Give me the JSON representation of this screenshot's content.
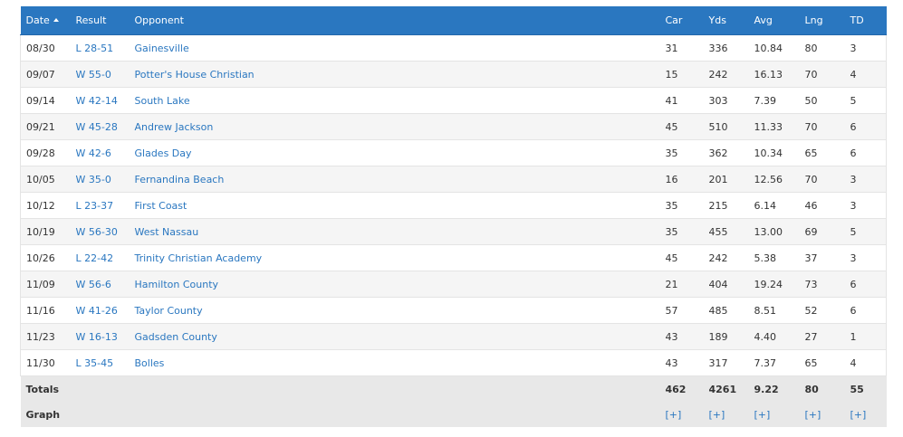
{
  "table": {
    "headers": {
      "date": "Date",
      "result": "Result",
      "opponent": "Opponent",
      "car": "Car",
      "yds": "Yds",
      "avg": "Avg",
      "lng": "Lng",
      "td": "TD"
    },
    "rows": [
      {
        "date": "08/30",
        "result": "L 28-51",
        "opponent": "Gainesville",
        "car": "31",
        "yds": "336",
        "avg": "10.84",
        "lng": "80",
        "td": "3"
      },
      {
        "date": "09/07",
        "result": "W 55-0",
        "opponent": "Potter's House Christian",
        "car": "15",
        "yds": "242",
        "avg": "16.13",
        "lng": "70",
        "td": "4"
      },
      {
        "date": "09/14",
        "result": "W 42-14",
        "opponent": "South Lake",
        "car": "41",
        "yds": "303",
        "avg": "7.39",
        "lng": "50",
        "td": "5"
      },
      {
        "date": "09/21",
        "result": "W 45-28",
        "opponent": "Andrew Jackson",
        "car": "45",
        "yds": "510",
        "avg": "11.33",
        "lng": "70",
        "td": "6"
      },
      {
        "date": "09/28",
        "result": "W 42-6",
        "opponent": "Glades Day",
        "car": "35",
        "yds": "362",
        "avg": "10.34",
        "lng": "65",
        "td": "6"
      },
      {
        "date": "10/05",
        "result": "W 35-0",
        "opponent": "Fernandina Beach",
        "car": "16",
        "yds": "201",
        "avg": "12.56",
        "lng": "70",
        "td": "3"
      },
      {
        "date": "10/12",
        "result": "L 23-37",
        "opponent": "First Coast",
        "car": "35",
        "yds": "215",
        "avg": "6.14",
        "lng": "46",
        "td": "3"
      },
      {
        "date": "10/19",
        "result": "W 56-30",
        "opponent": "West Nassau",
        "car": "35",
        "yds": "455",
        "avg": "13.00",
        "lng": "69",
        "td": "5"
      },
      {
        "date": "10/26",
        "result": "L 22-42",
        "opponent": "Trinity Christian Academy",
        "car": "45",
        "yds": "242",
        "avg": "5.38",
        "lng": "37",
        "td": "3"
      },
      {
        "date": "11/09",
        "result": "W 56-6",
        "opponent": "Hamilton County",
        "car": "21",
        "yds": "404",
        "avg": "19.24",
        "lng": "73",
        "td": "6"
      },
      {
        "date": "11/16",
        "result": "W 41-26",
        "opponent": "Taylor County",
        "car": "57",
        "yds": "485",
        "avg": "8.51",
        "lng": "52",
        "td": "6"
      },
      {
        "date": "11/23",
        "result": "W 16-13",
        "opponent": "Gadsden County",
        "car": "43",
        "yds": "189",
        "avg": "4.40",
        "lng": "27",
        "td": "1"
      },
      {
        "date": "11/30",
        "result": "L 35-45",
        "opponent": "Bolles",
        "car": "43",
        "yds": "317",
        "avg": "7.37",
        "lng": "65",
        "td": "4"
      }
    ],
    "totals": {
      "label": "Totals",
      "car": "462",
      "yds": "4261",
      "avg": "9.22",
      "lng": "80",
      "td": "55"
    },
    "graph": {
      "label": "Graph",
      "link_label": "[+]"
    }
  }
}
